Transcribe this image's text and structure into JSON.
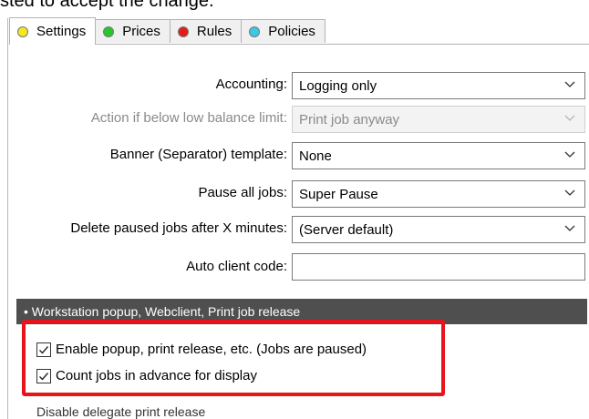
{
  "instruction_text": "sted to accept the change.",
  "tabs": [
    {
      "label": "Settings",
      "color": "#f5e81e",
      "active": true
    },
    {
      "label": "Prices",
      "color": "#25c72b",
      "active": false
    },
    {
      "label": "Rules",
      "color": "#e21b1b",
      "active": false
    },
    {
      "label": "Policies",
      "color": "#3cc7e6",
      "active": false
    }
  ],
  "form": {
    "accounting_label": "Accounting:",
    "accounting_value": "Logging only",
    "low_balance_label": "Action if below low balance limit:",
    "low_balance_value": "Print job anyway",
    "banner_label": "Banner (Separator) template:",
    "banner_value": "None",
    "pause_label": "Pause all jobs:",
    "pause_value": "Super Pause",
    "delete_label": "Delete paused jobs after X minutes:",
    "delete_value": "(Server default)",
    "client_code_label": "Auto client code:",
    "client_code_value": ""
  },
  "section": {
    "title": "• Workstation popup, Webclient, Print job release"
  },
  "checkboxes": [
    {
      "label": "Enable popup, print release, etc. (Jobs are paused)",
      "checked": true
    },
    {
      "label": "Count jobs in advance for display",
      "checked": true
    }
  ],
  "cut_row_text": "Disable delegate print release",
  "highlight_color": "#e8141c"
}
